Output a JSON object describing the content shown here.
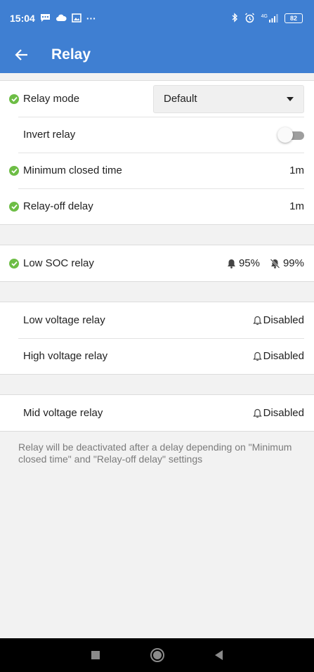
{
  "status_bar": {
    "time": "15:04",
    "more": "···",
    "signal_label": "4G",
    "battery": "82"
  },
  "app_bar": {
    "title": "Relay",
    "color": "#3f7fd2"
  },
  "settings": {
    "relay_mode": {
      "label": "Relay mode",
      "value": "Default"
    },
    "invert_relay": {
      "label": "Invert relay",
      "on": false
    },
    "min_closed_time": {
      "label": "Minimum closed time",
      "value": "1m"
    },
    "relay_off_delay": {
      "label": "Relay-off delay",
      "value": "1m"
    },
    "low_soc_relay": {
      "label": "Low SOC relay",
      "set_value": "95%",
      "clear_value": "99%"
    },
    "low_voltage_relay": {
      "label": "Low voltage relay",
      "value": "Disabled"
    },
    "high_voltage_relay": {
      "label": "High voltage relay",
      "value": "Disabled"
    },
    "mid_voltage_relay": {
      "label": "Mid voltage relay",
      "value": "Disabled"
    }
  },
  "note": "Relay will be deactivated after a delay depending on \"Minimum closed time\" and \"Relay-off delay\" settings",
  "colors": {
    "check": "#6dbd45",
    "accent": "#3f7fd2"
  }
}
